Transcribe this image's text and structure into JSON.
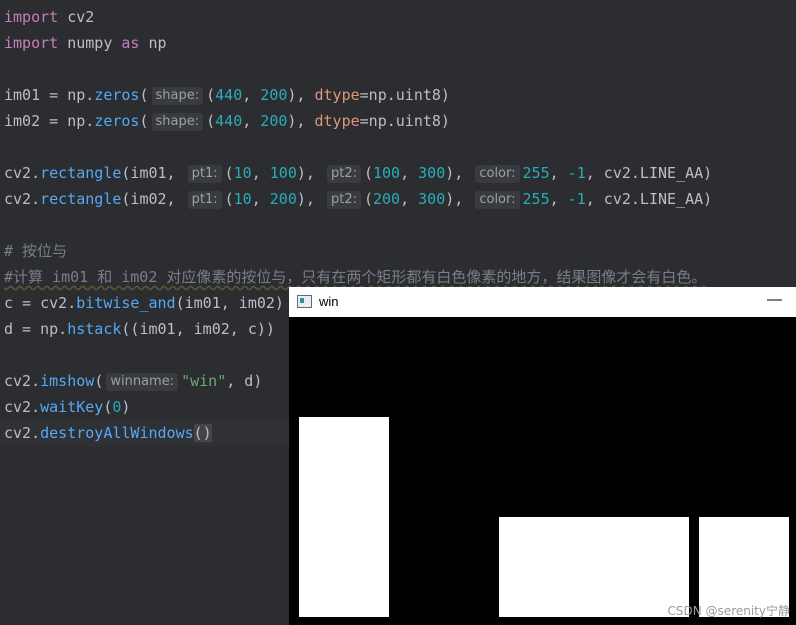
{
  "code": {
    "l1": {
      "kw": "import",
      "rest": " cv2"
    },
    "l2": {
      "kw": "import",
      "mid": " numpy ",
      "kw2": "as",
      "rest": " np"
    },
    "l4": {
      "a": "im01 = np.",
      "fn": "zeros",
      "b": "(",
      "hint": "shape:",
      "n1": "440",
      "c": ", ",
      "n2": "200",
      "d": "), ",
      "p": "dtype",
      "e": "=np.uint8)"
    },
    "l5": {
      "a": "im02 = np.",
      "fn": "zeros",
      "b": "(",
      "hint": "shape:",
      "n1": "440",
      "c": ", ",
      "n2": "200",
      "d": "), ",
      "p": "dtype",
      "e": "=np.uint8)"
    },
    "l7": {
      "a": "cv2.",
      "fn": "rectangle",
      "b": "(im01, ",
      "h1": "pt1:",
      "c": "(",
      "n1": "10",
      "d": ", ",
      "n2": "100",
      "e": "), ",
      "h2": "pt2:",
      "f": "(",
      "n3": "100",
      "g": ", ",
      "n4": "300",
      "h": "), ",
      "h3": "color:",
      "n5": "255",
      "i": ", ",
      "n6": "-1",
      "j": ", cv2.LINE_AA)"
    },
    "l8": {
      "a": "cv2.",
      "fn": "rectangle",
      "b": "(im02, ",
      "h1": "pt1:",
      "c": "(",
      "n1": "10",
      "d": ", ",
      "n2": "200",
      "e": "), ",
      "h2": "pt2:",
      "f": "(",
      "n3": "200",
      "g": ", ",
      "n4": "300",
      "h": "), ",
      "h3": "color:",
      "n5": "255",
      "i": ", ",
      "n6": "-1",
      "j": ", cv2.LINE_AA)"
    },
    "l10": "# 按位与",
    "l11": "#计算 im01 和 im02 对应像素的按位与，只有在两个矩形都有白色像素的地方，结果图像才会有白色。",
    "l12": {
      "a": "c = cv2.",
      "fn": "bitwise_and",
      "b": "(im01, im02)"
    },
    "l13": {
      "a": "d = np.",
      "fn": "hstack",
      "b": "((im01, im02, c))"
    },
    "l15": {
      "a": "cv2.",
      "fn": "imshow",
      "b": "(",
      "hint": "winname:",
      "s": "\"win\"",
      "c": ", d)"
    },
    "l16": {
      "a": "cv2.",
      "fn": "waitKey",
      "b": "(",
      "n": "0",
      "c": ")"
    },
    "l17": {
      "a": "cv2.",
      "fn": "destroyAllWindows",
      "b": "()"
    }
  },
  "window": {
    "title": "win",
    "minimize": "—",
    "watermark": "CSDN @serenity宁静"
  }
}
